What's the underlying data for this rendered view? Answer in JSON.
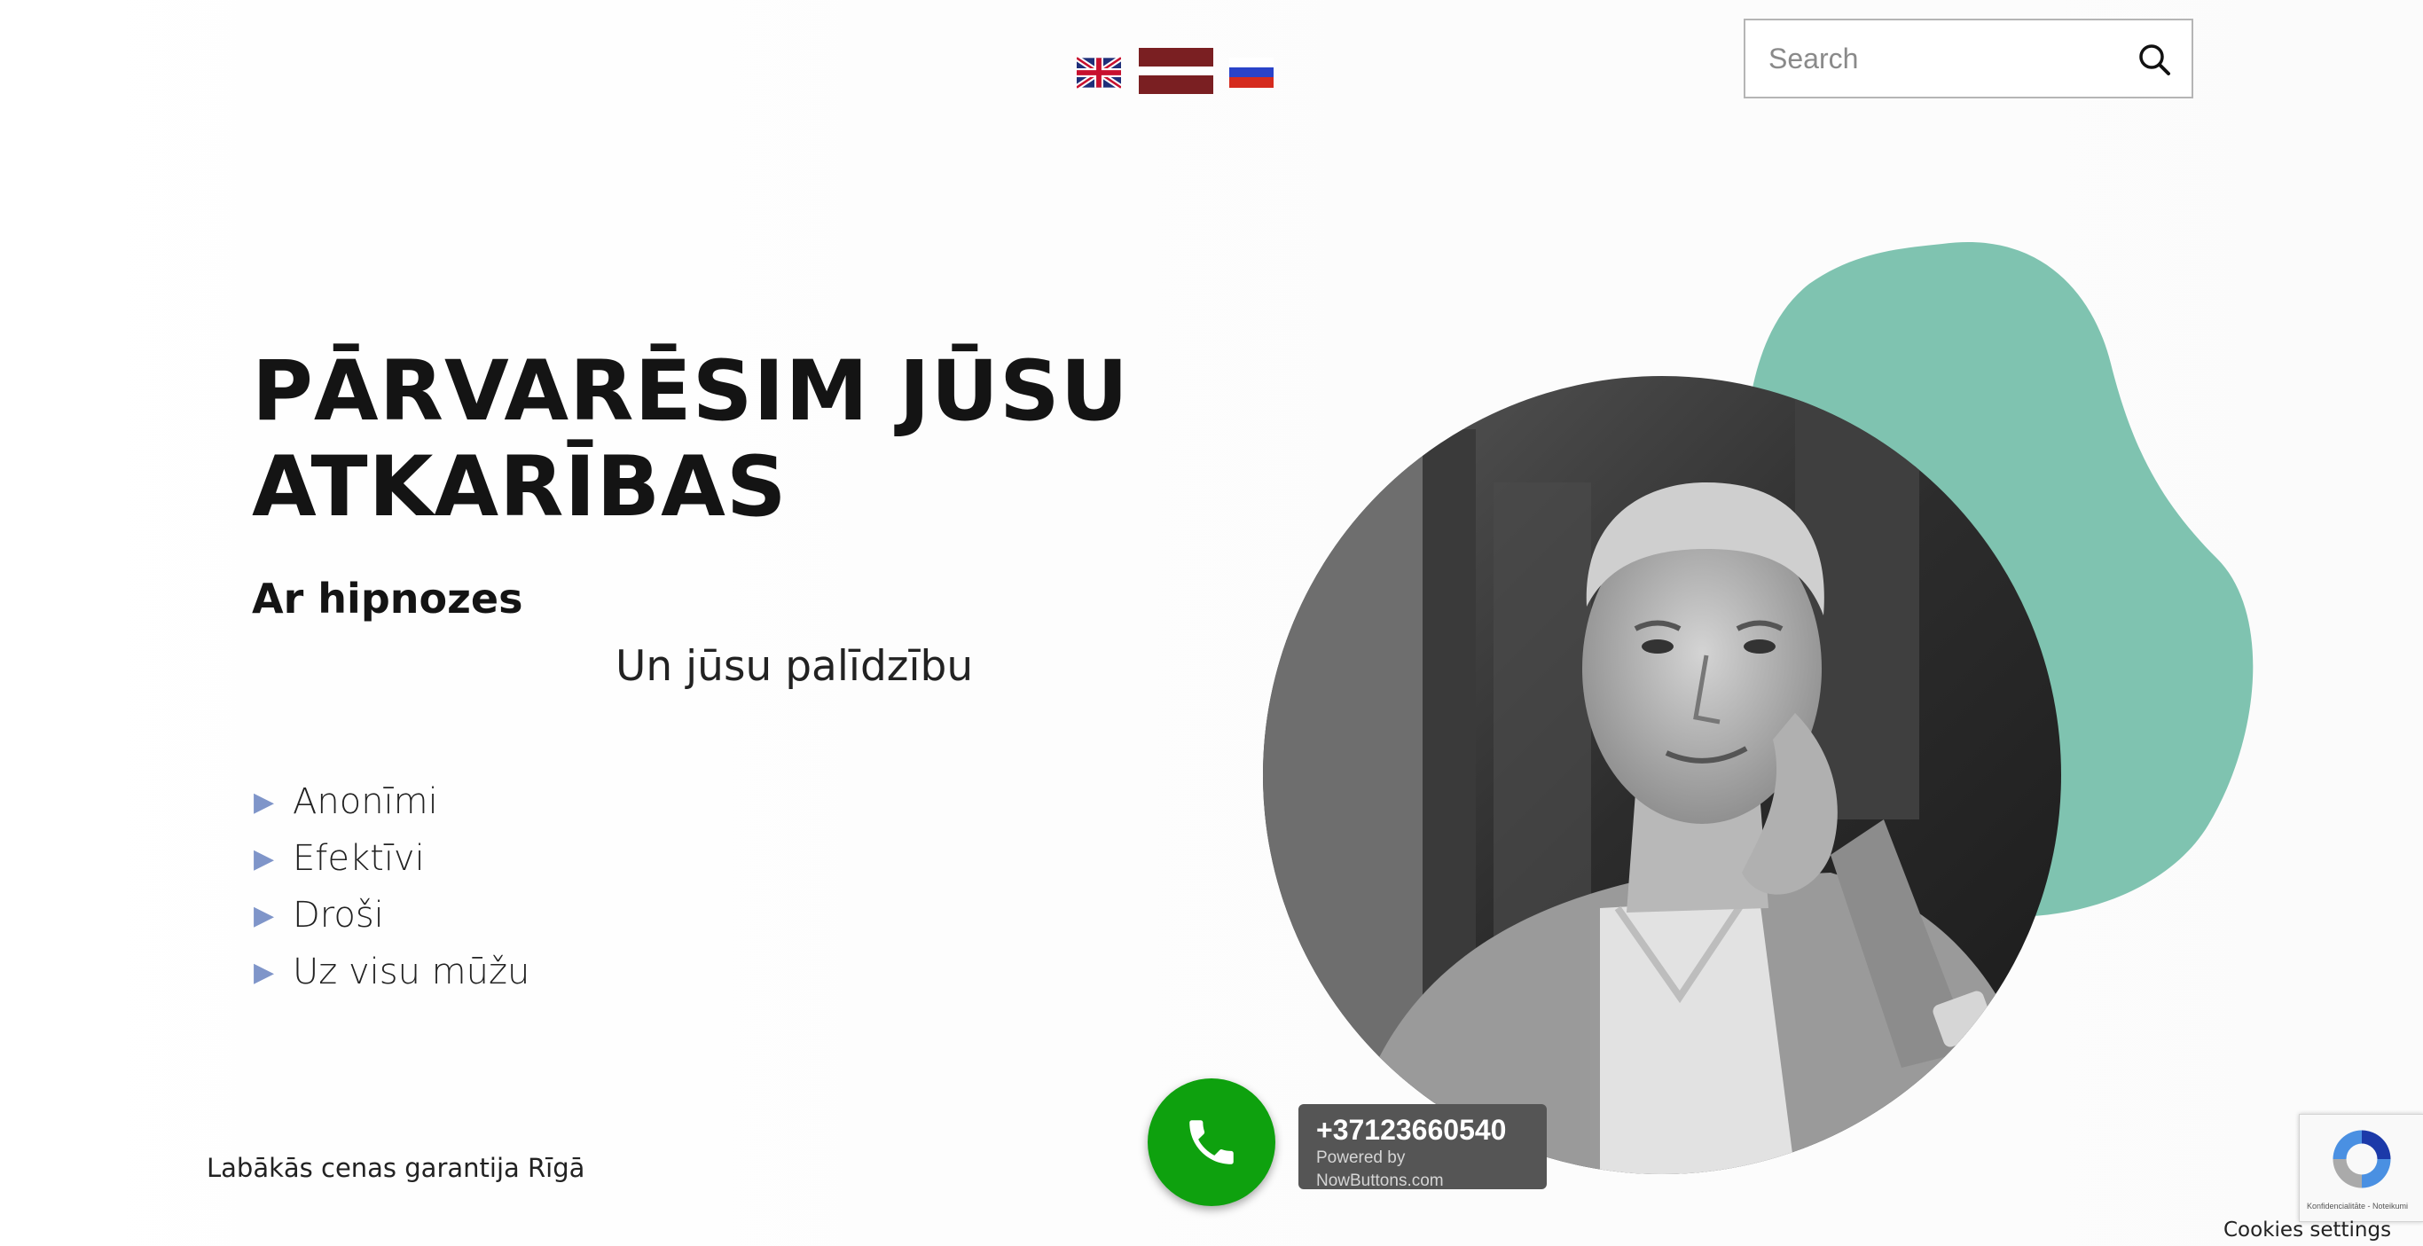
{
  "header": {
    "languages": [
      {
        "name": "English",
        "icon": "uk-flag-icon"
      },
      {
        "name": "Latviešu",
        "icon": "latvia-flag-icon"
      },
      {
        "name": "Русский",
        "icon": "russia-flag-icon"
      }
    ],
    "search": {
      "placeholder": "Search",
      "value": "",
      "icon": "search-icon"
    }
  },
  "hero": {
    "title": "PĀRVARĒSIM JŪSU ATKARĪBAS",
    "subtitle": "Ar hipnozes",
    "tagline": "Un jūsu palīdzību",
    "features": [
      "Anonīmi",
      "Efektīvi",
      "Droši",
      "Uz visu mūžu"
    ],
    "guarantee": "Labākās cenas garantija Rīgā"
  },
  "colors": {
    "blob": "#7fc3b0",
    "call_button": "#0ea10e",
    "call_label_bg": "#555555",
    "bullet": "#7f95c9",
    "latvia_red": "#7a1f22"
  },
  "call_widget": {
    "number": "+37123660540",
    "powered_by": "Powered by NowButtons.com",
    "icon": "phone-icon"
  },
  "recaptcha": {
    "text": "Konfidencialitāte - Noteikumi",
    "icon": "recaptcha-icon"
  },
  "cookies": {
    "label": "Cookies settings"
  }
}
